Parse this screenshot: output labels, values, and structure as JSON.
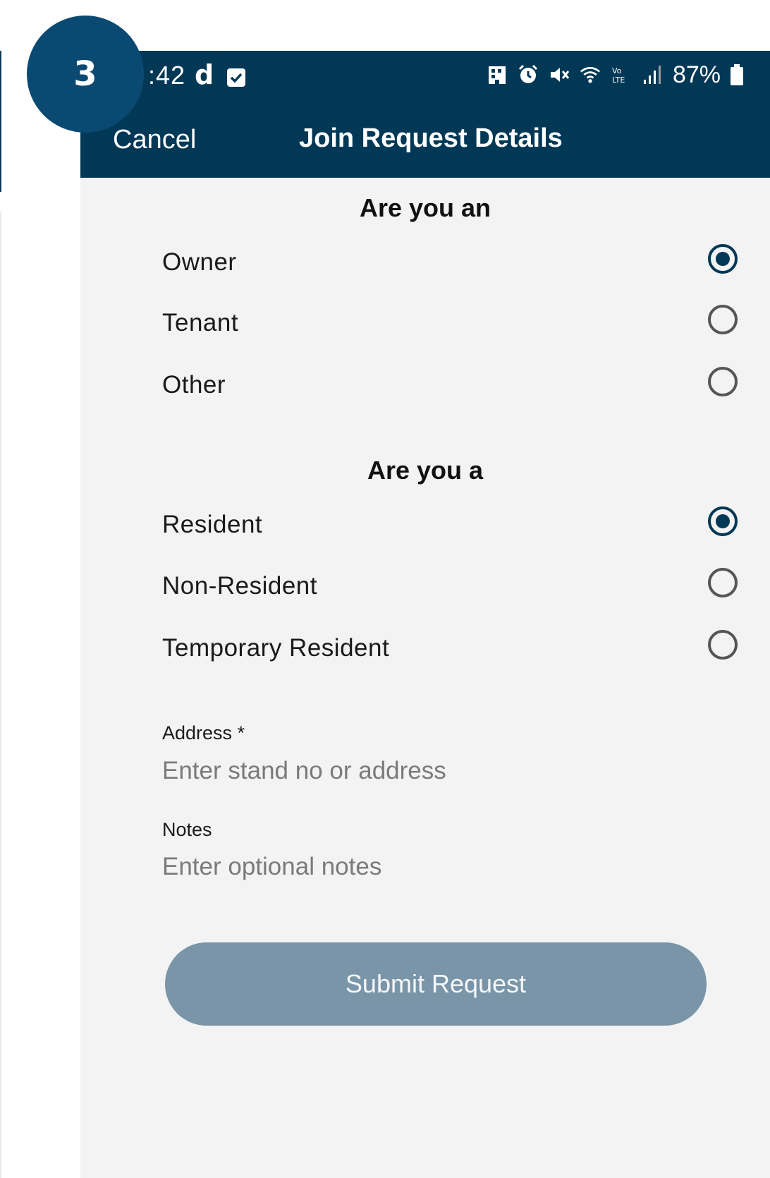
{
  "step_badge": "3",
  "status_bar": {
    "time": ":42",
    "app_letter": "d",
    "battery": "87%"
  },
  "app_bar": {
    "cancel_label": "Cancel",
    "title": "Join Request Details"
  },
  "question_ownership": {
    "title": "Are you an",
    "options": [
      {
        "label": "Owner",
        "selected": true
      },
      {
        "label": "Tenant",
        "selected": false
      },
      {
        "label": "Other",
        "selected": false
      }
    ]
  },
  "question_residency": {
    "title": "Are you a",
    "options": [
      {
        "label": "Resident",
        "selected": true
      },
      {
        "label": "Non-Resident",
        "selected": false
      },
      {
        "label": "Temporary Resident",
        "selected": false
      }
    ]
  },
  "address": {
    "label": "Address *",
    "placeholder": "Enter stand no or address",
    "value": ""
  },
  "notes": {
    "label": "Notes",
    "placeholder": "Enter optional notes",
    "value": ""
  },
  "submit_label": "Submit Request",
  "colors": {
    "primary": "#013856",
    "button_disabled": "#7a95a8",
    "background": "#f3f3f3",
    "badge": "#0a4a72"
  }
}
